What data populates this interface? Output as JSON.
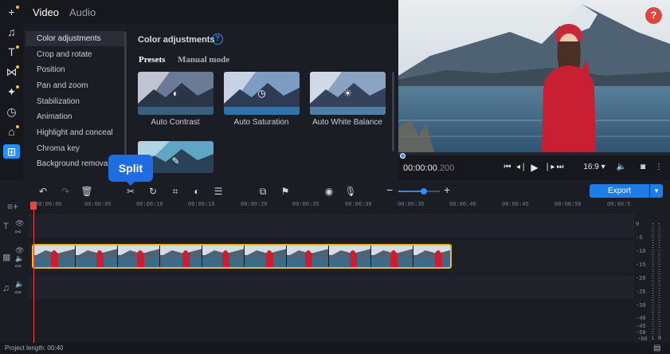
{
  "tabs": {
    "video": "Video",
    "audio": "Audio"
  },
  "rail_icons": [
    "plus-icon",
    "music-icon",
    "text-icon",
    "transitions-icon",
    "magic-icon",
    "clock-icon",
    "stickers-icon",
    "more-tools-icon"
  ],
  "categories": [
    "Color adjustments",
    "Crop and rotate",
    "Position",
    "Pan and zoom",
    "Stabilization",
    "Animation",
    "Highlight and conceal",
    "Chroma key",
    "Background removal"
  ],
  "panel": {
    "title": "Color adjustments",
    "help": "?",
    "subtabs": {
      "presets": "Presets",
      "manual": "Manual mode"
    },
    "presets": [
      "Auto Contrast",
      "Auto Saturation",
      "Auto White Balance"
    ]
  },
  "preview": {
    "help": "?",
    "time_main": "00:00:00",
    "time_ms": ".200",
    "aspect": "16:9 ▾"
  },
  "tooltip": "Split",
  "export": {
    "label": "Export",
    "dropdown": "▾"
  },
  "ruler_ticks": [
    "00:00:00",
    "00:00:05",
    "00:00:10",
    "00:00:15",
    "00:00:20",
    "00:00:25",
    "00:00:30",
    "00:00:35",
    "00:00:40",
    "00:00:45",
    "00:00:50",
    "00:00:5"
  ],
  "meter_labels": [
    "0",
    "-5",
    "-10",
    "-15",
    "-20",
    "-25",
    "-30",
    "-40",
    "-45",
    "-50",
    "-60"
  ],
  "meter_channels": {
    "left": "L",
    "right": "R"
  },
  "status": "Project length: 00:40",
  "colors": {
    "accent": "#1e7de6",
    "playhead": "#e84545",
    "clip_border": "#e6b831",
    "help_red": "#d9473d"
  }
}
